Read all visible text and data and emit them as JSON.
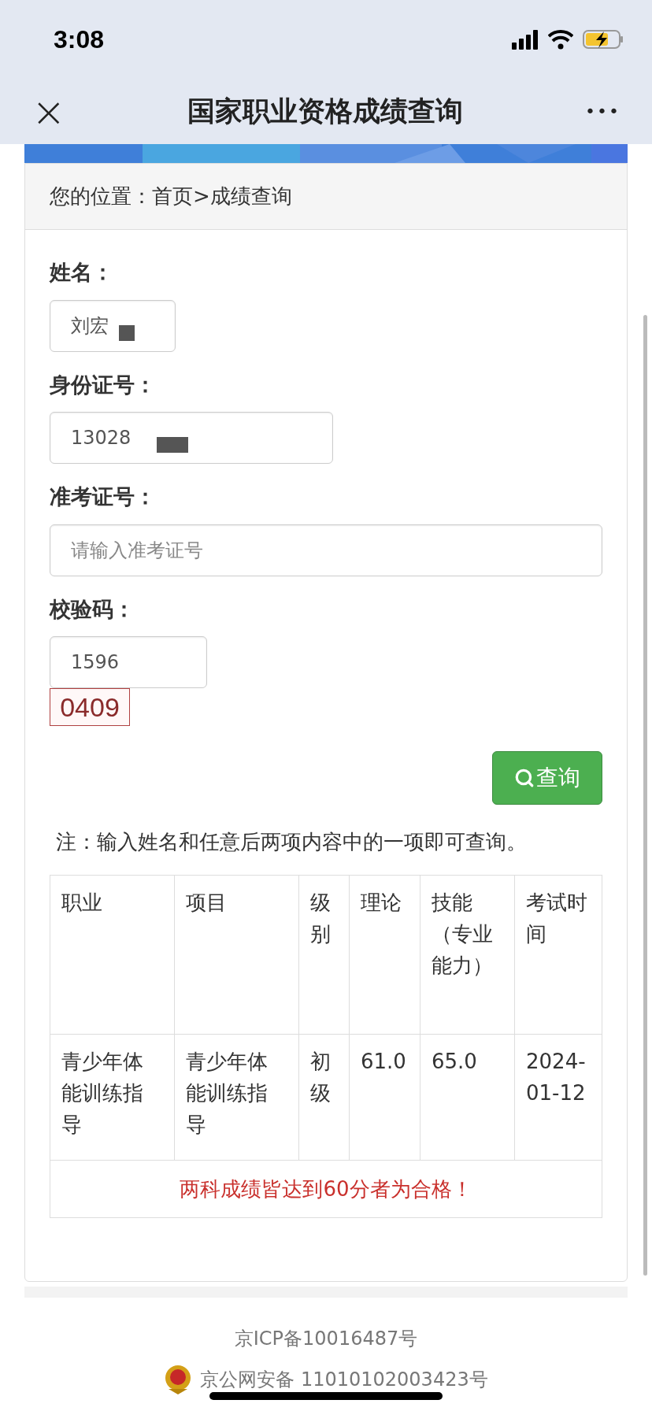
{
  "status_bar": {
    "time": "3:08"
  },
  "nav_bar": {
    "close": "×",
    "title": "国家职业资格成绩查询",
    "more": "•••"
  },
  "breadcrumb": "您的位置：首页>成绩查询",
  "form": {
    "fields": [
      {
        "label": "姓名：",
        "value": "刘宏",
        "redacted": true
      },
      {
        "label": "身份证号：",
        "value": "13028",
        "redacted": true
      },
      {
        "label": "准考证号：",
        "placeholder": "请输入准考证号",
        "redacted": false
      },
      {
        "label": "校验码：",
        "value": "1596",
        "redacted": false
      }
    ],
    "captcha": "0409",
    "submit": "查询"
  },
  "note": "注：输入姓名和任意后两项内容中的一项即可查询。",
  "table": {
    "columns": [
      "职业",
      "项目",
      "级别",
      "理论",
      "技能（专业能力）",
      "考试时间"
    ],
    "rows": [
      [
        "青少年体能训练指导",
        "青少年体能训练指导",
        "初级",
        "61.0",
        "65.0",
        "2024-01-12"
      ]
    ],
    "footer": "两科成绩皆达到60分者为合格！"
  },
  "footer": {
    "icp": "京ICP备10016487号",
    "police": "京公网安备 11010102003423号"
  }
}
